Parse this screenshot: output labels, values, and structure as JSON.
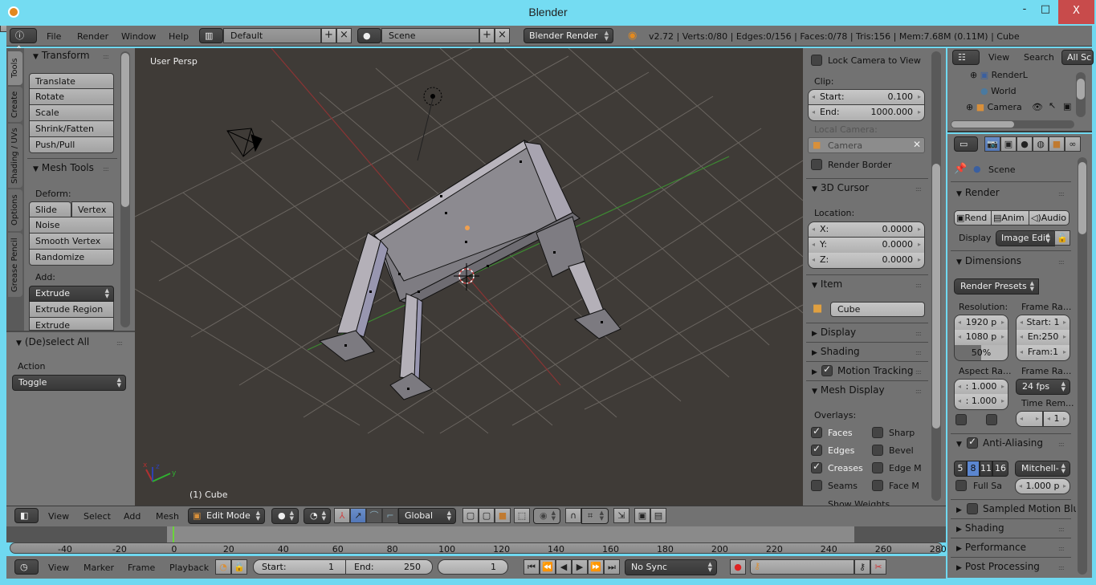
{
  "window": {
    "title": "Blender",
    "min": "-",
    "max": "□",
    "close": "X"
  },
  "info_header": {
    "menus": [
      "File",
      "Render",
      "Window",
      "Help"
    ],
    "layout": "Default",
    "scene": "Scene",
    "engine": "Blender Render",
    "stats": "v2.72 | Verts:0/80 | Edges:0/156 | Faces:0/78 | Tris:156 | Mem:7.68M (0.11M) | Cube"
  },
  "tool_tabs": [
    "Tools",
    "Create",
    "Shading / UVs",
    "Options",
    "Grease Pencil"
  ],
  "tool_shelf": {
    "transform": {
      "title": "Transform",
      "buttons": [
        "Translate",
        "Rotate",
        "Scale",
        "Shrink/Fatten",
        "Push/Pull"
      ]
    },
    "mesh_tools": {
      "title": "Mesh Tools",
      "deform_label": "Deform:",
      "deform_pair": [
        "Slide Ed",
        "Vertex"
      ],
      "deform_buttons": [
        "Noise",
        "Smooth Vertex",
        "Randomize"
      ],
      "add_label": "Add:",
      "extrude": "Extrude",
      "add_buttons": [
        "Extrude Region",
        "Extrude Individual"
      ]
    }
  },
  "operator_panel": {
    "title": "(De)select All",
    "action_label": "Action",
    "action_value": "Toggle"
  },
  "viewport": {
    "view_label": "User Persp",
    "object_label": "(1) Cube",
    "axes": [
      "x",
      "y",
      "z"
    ]
  },
  "n_panel": {
    "lock_camera": "Lock Camera to View",
    "clip_label": "Clip:",
    "clip_start_label": "Start:",
    "clip_start": "0.100",
    "clip_end_label": "End:",
    "clip_end": "1000.000",
    "local_camera_label": "Local Camera:",
    "local_camera": "Camera",
    "render_border": "Render Border",
    "cursor_title": "3D Cursor",
    "location_label": "Location:",
    "cursor": [
      {
        "axis": "X:",
        "value": "0.0000"
      },
      {
        "axis": "Y:",
        "value": "0.0000"
      },
      {
        "axis": "Z:",
        "value": "0.0000"
      }
    ],
    "item_title": "Item",
    "item_name": "Cube",
    "display_title": "Display",
    "shading_title": "Shading",
    "motion_tracking_title": "Motion Tracking",
    "mesh_display_title": "Mesh Display",
    "overlays_label": "Overlays:",
    "overlays": [
      {
        "label": "Faces",
        "checked": true
      },
      {
        "label": "Sharp",
        "checked": false
      },
      {
        "label": "Edges",
        "checked": true
      },
      {
        "label": "Bevel",
        "checked": false
      },
      {
        "label": "Creases",
        "checked": true
      },
      {
        "label": "Edge M",
        "checked": false
      },
      {
        "label": "Seams",
        "checked": false
      },
      {
        "label": "Face M",
        "checked": false
      }
    ],
    "show_weights": "Show Weights"
  },
  "outliner": {
    "menus": [
      "View",
      "Search"
    ],
    "filter": "All Sc",
    "items": [
      "RenderL",
      "World",
      "Camera"
    ]
  },
  "properties": {
    "scene": "Scene",
    "render_title": "Render",
    "render_buttons": [
      "Rend",
      "Anim",
      "Audio"
    ],
    "display_label": "Display",
    "display_value": "Image Edit",
    "dimensions_title": "Dimensions",
    "render_presets": "Render Presets",
    "resolution_label": "Resolution:",
    "res_x": "1920 p",
    "res_y": "1080 p",
    "res_pct": "50%",
    "frame_range_label": "Frame Ra...",
    "frame_start": "Start: 1",
    "frame_end": "En:250",
    "frame_step": "Fram:1",
    "aspect_label": "Aspect Ra...",
    "aspect_x": ": 1.000",
    "aspect_y": ": 1.000",
    "frame_rate_label": "Frame Ra...",
    "fps": "24 fps",
    "time_remap_label": "Time Rem...",
    "time_remap": "1",
    "aa_title": "Anti-Aliasing",
    "aa_samples": [
      "5",
      "8",
      "11",
      "16"
    ],
    "aa_selected": "8",
    "aa_filter": "Mitchell-",
    "full_sample": "Full Sa",
    "filter_size": "1.000 p",
    "collapsed": [
      "Sampled Motion Blur",
      "Shading",
      "Performance",
      "Post Processing"
    ]
  },
  "view3d_header": {
    "menus": [
      "View",
      "Select",
      "Add",
      "Mesh"
    ],
    "mode": "Edit Mode",
    "orientation": "Global"
  },
  "timeline": {
    "ticks": [
      "-40",
      "-20",
      "0",
      "20",
      "40",
      "60",
      "80",
      "100",
      "120",
      "140",
      "160",
      "180",
      "200",
      "220",
      "240",
      "260",
      "280"
    ],
    "current_frame_value": 1,
    "menus": [
      "View",
      "Marker",
      "Frame",
      "Playback"
    ],
    "start_label": "Start:",
    "start": "1",
    "end_label": "End:",
    "end": "250",
    "current": "1",
    "sync": "No Sync"
  }
}
